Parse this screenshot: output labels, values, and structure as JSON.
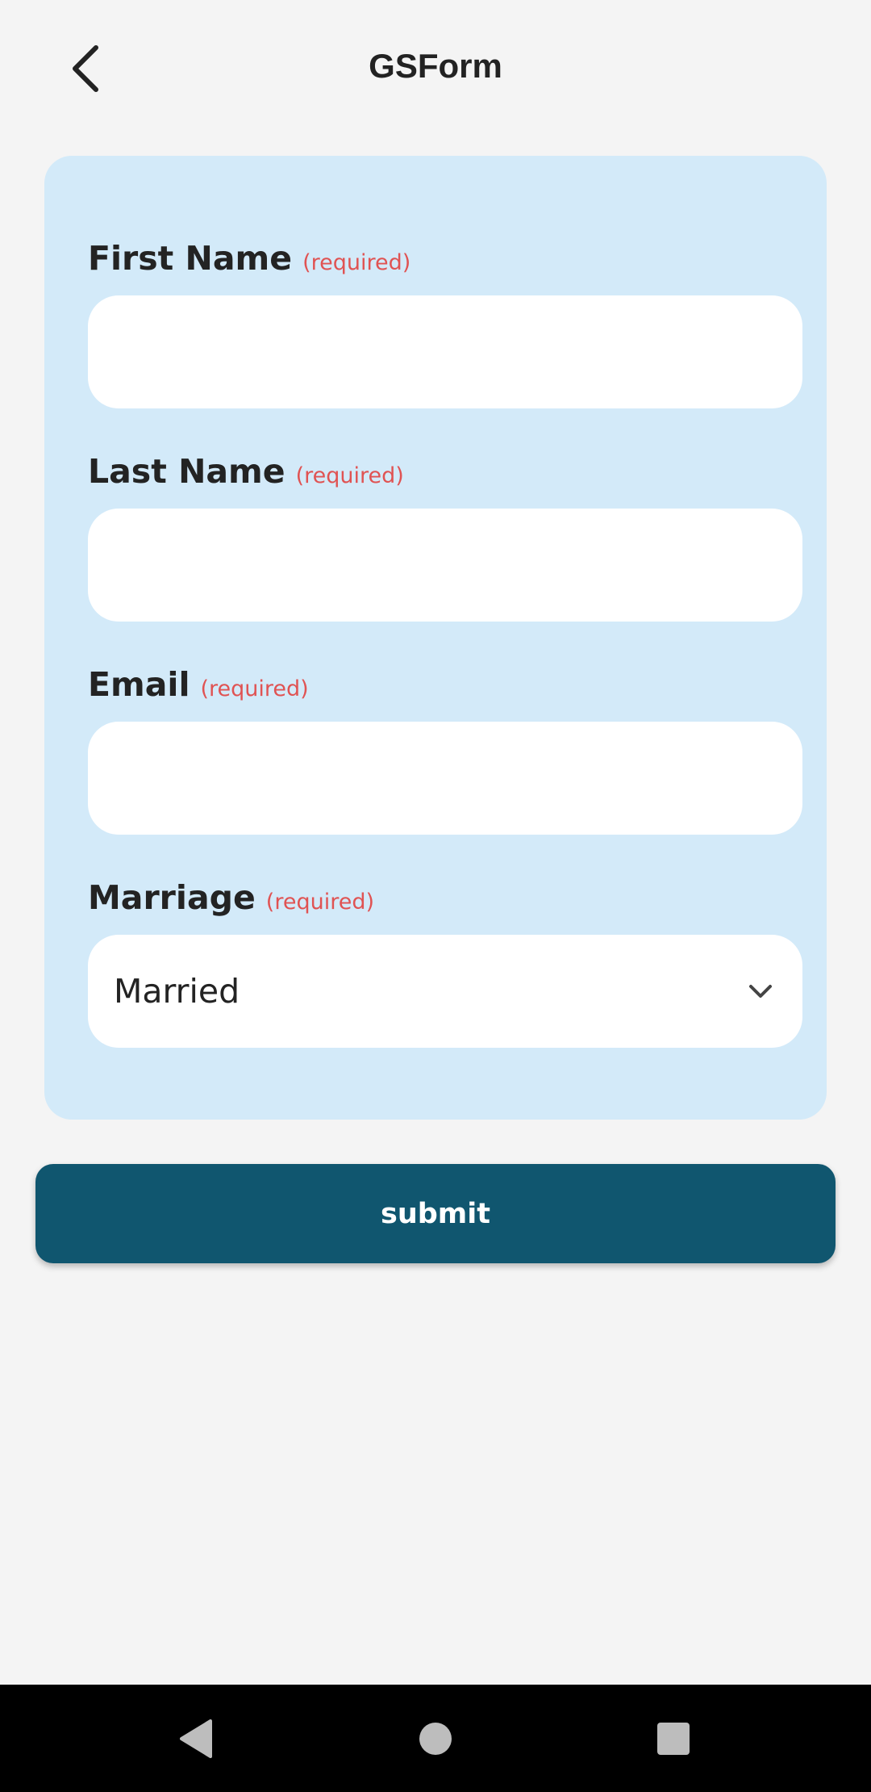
{
  "header": {
    "title": "GSForm",
    "back_icon": "chevron-left-icon"
  },
  "form": {
    "fields": [
      {
        "label": "First Name",
        "required": "(required)",
        "value": "",
        "placeholder": ""
      },
      {
        "label": "Last Name",
        "required": "(required)",
        "value": "",
        "placeholder": ""
      },
      {
        "label": "Email",
        "required": "(required)",
        "value": "",
        "placeholder": ""
      },
      {
        "label": "Marriage",
        "required": "(required)",
        "selected": "Married",
        "icon": "chevron-down-icon"
      }
    ],
    "submit_label": "submit"
  },
  "nav_bar": {
    "back_icon": "triangle-back-icon",
    "home_icon": "circle-home-icon",
    "recents_icon": "square-recents-icon"
  },
  "colors": {
    "background": "#f4f4f4",
    "card": "#d3eaf9",
    "required": "#e05353",
    "button": "#10566f",
    "text": "#232323"
  }
}
